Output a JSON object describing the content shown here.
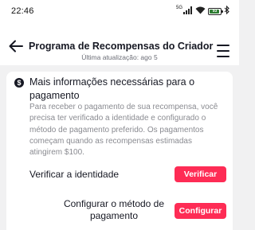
{
  "status_bar": {
    "time": "22:46",
    "signal_label": "5G",
    "battery_level": "93",
    "icons": [
      "signal-icon",
      "wifi-icon",
      "battery-icon",
      "bluetooth-icon"
    ]
  },
  "header": {
    "title": "Programa de Recompensas do Criador",
    "subtitle": "Última atualização: ago 5",
    "back_icon": "back-arrow-icon",
    "menu_icon": "hamburger-menu-icon"
  },
  "card": {
    "icon": "info-dollar-icon",
    "icon_glyph": "$",
    "heading": "Mais informações necessárias para o pagamento",
    "body": "Para receber o pagamento de sua recompensa, você precisa ter verificado a identidade e configurado o método de pagamento preferido. Os pagamentos começam quando as recompensas estimadas atingirem $100.",
    "rows": [
      {
        "label": "Verificar a identidade",
        "button": "Verificar"
      },
      {
        "label": "Configurar o método de pagamento",
        "button": "Configurar"
      }
    ]
  },
  "colors": {
    "accent": "#fe2c55",
    "background": "#f1f1f2",
    "card": "#ffffff",
    "text_primary": "#161823",
    "text_secondary": "#8a8b91"
  }
}
